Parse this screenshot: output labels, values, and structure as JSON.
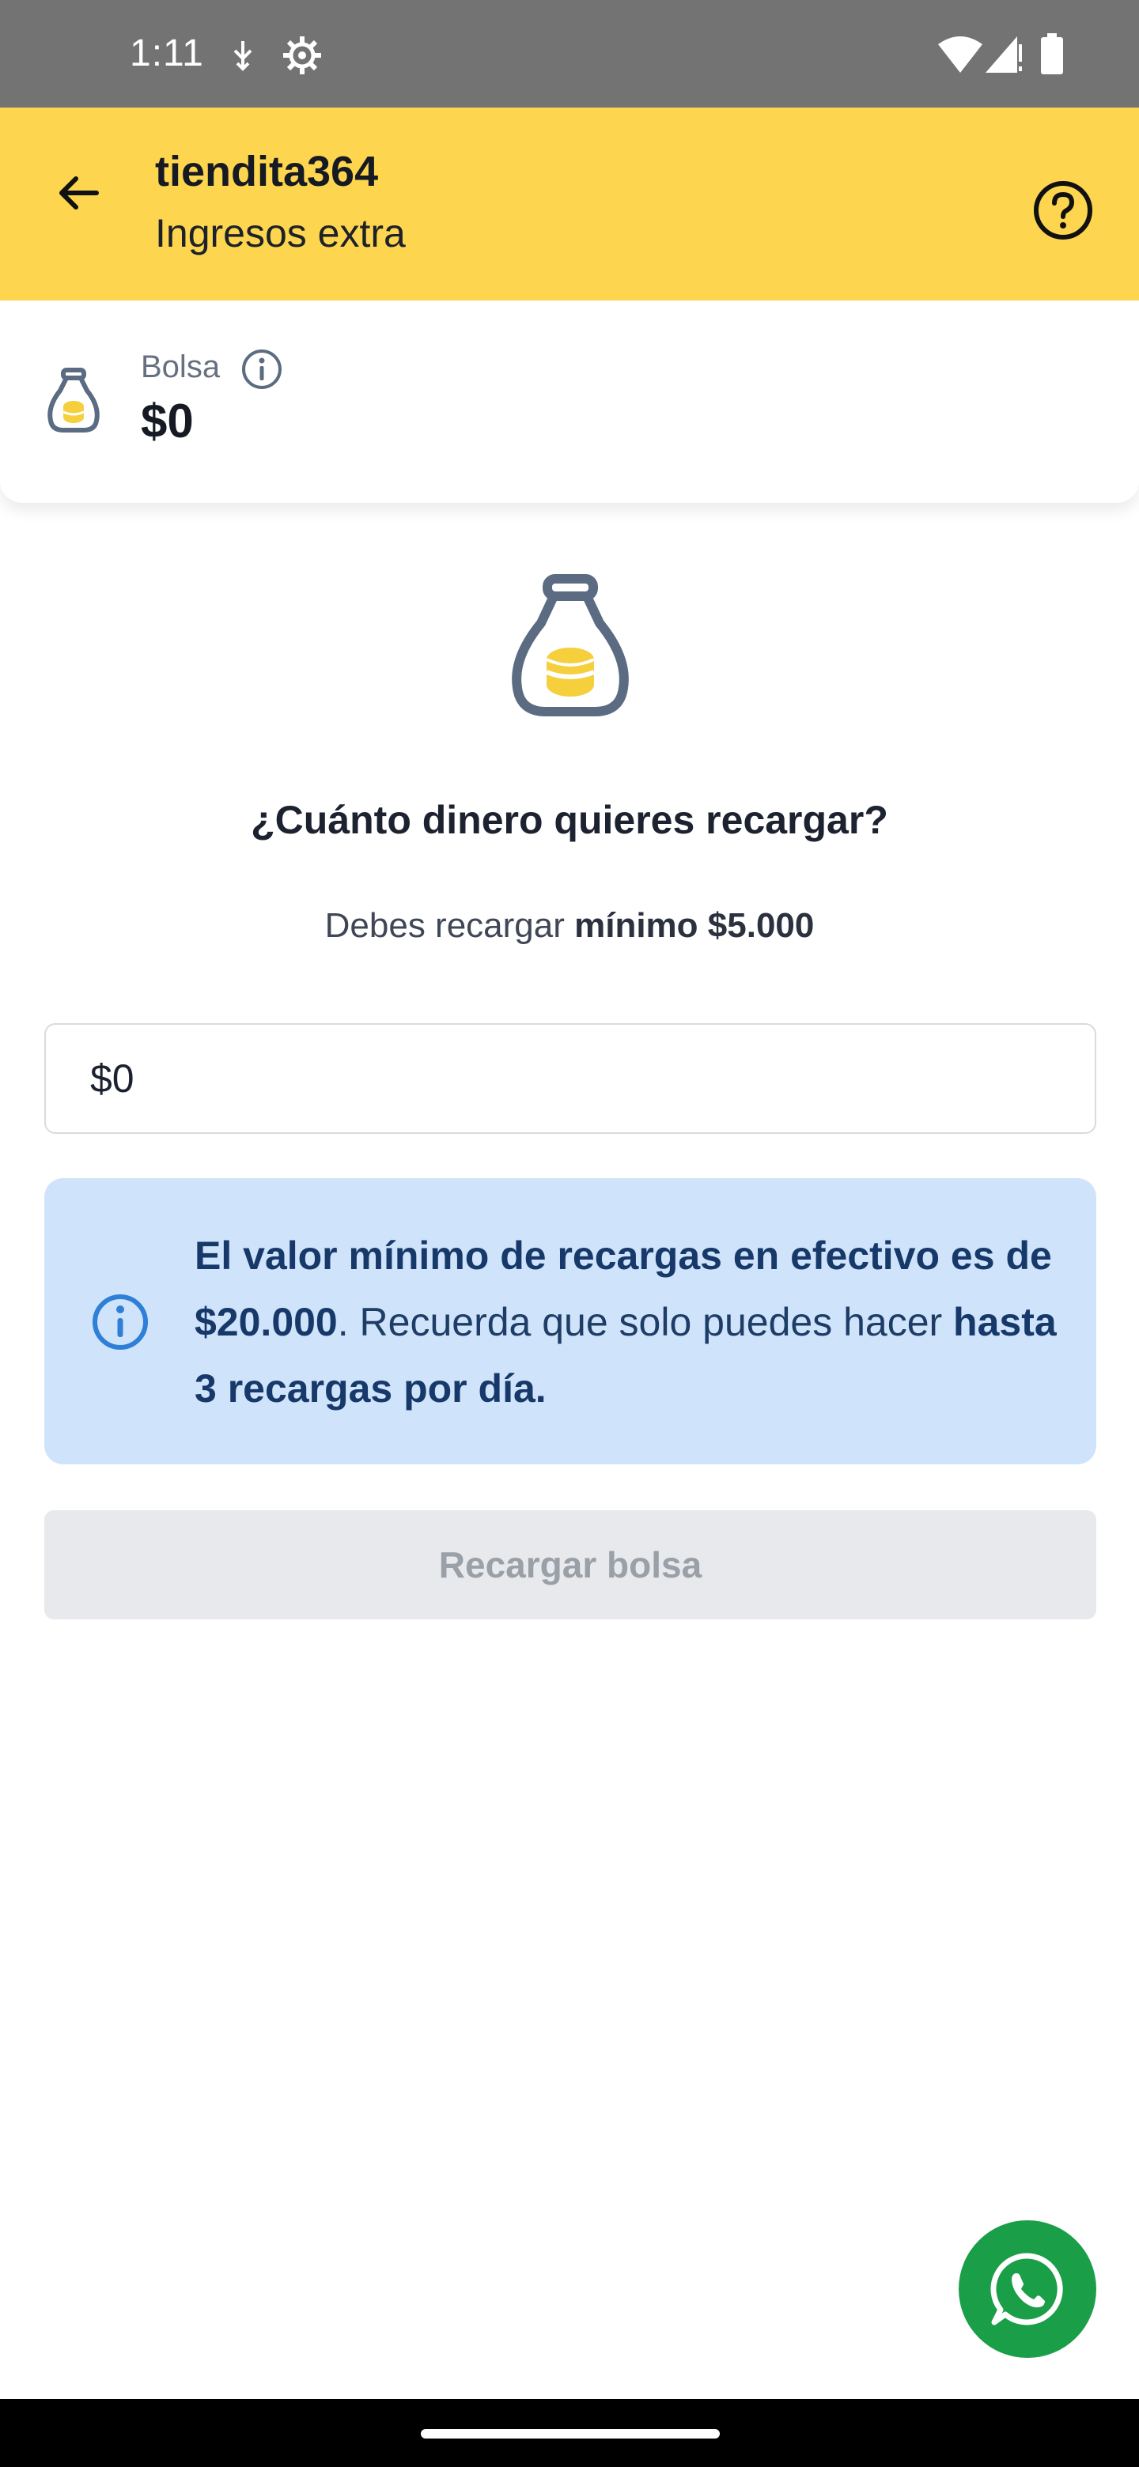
{
  "status_bar": {
    "time": "1:11",
    "icons": [
      "usb-debug-icon",
      "settings-gear-icon",
      "wifi-icon",
      "signal-icon",
      "battery-icon"
    ]
  },
  "app_bar": {
    "title": "tiendita364",
    "subtitle": "Ingresos extra",
    "back_icon": "arrow-left-icon",
    "help_icon": "help-circle-icon"
  },
  "balance": {
    "label": "Bolsa",
    "amount": "$0",
    "icon": "money-bag-icon"
  },
  "main": {
    "question": "¿Cuánto dinero quieres recargar?",
    "min_note_prefix": "Debes recargar ",
    "min_note_bold": "mínimo $5.000",
    "amount_value": "$0"
  },
  "info_box": {
    "bold_1": "El valor mínimo de recargas en efectivo es de $20.000",
    "text_1": ". Recuerda que solo puedes hacer ",
    "bold_2": "hasta 3 recargas por día."
  },
  "recharge_button": {
    "label": "Recargar bolsa",
    "enabled": false
  },
  "fab": {
    "icon": "whatsapp-icon"
  },
  "colors": {
    "app_bar": "#fed54e",
    "info_bg": "#cfe3fb",
    "info_text": "#1e3d66",
    "info_icon": "#2f7fd6",
    "bag_outline": "#5a6b82",
    "bag_coins": "#f5cf3c",
    "whatsapp": "#1a9e48",
    "button_disabled_bg": "#e8e9ec",
    "button_disabled_text": "#9aa0a8"
  }
}
